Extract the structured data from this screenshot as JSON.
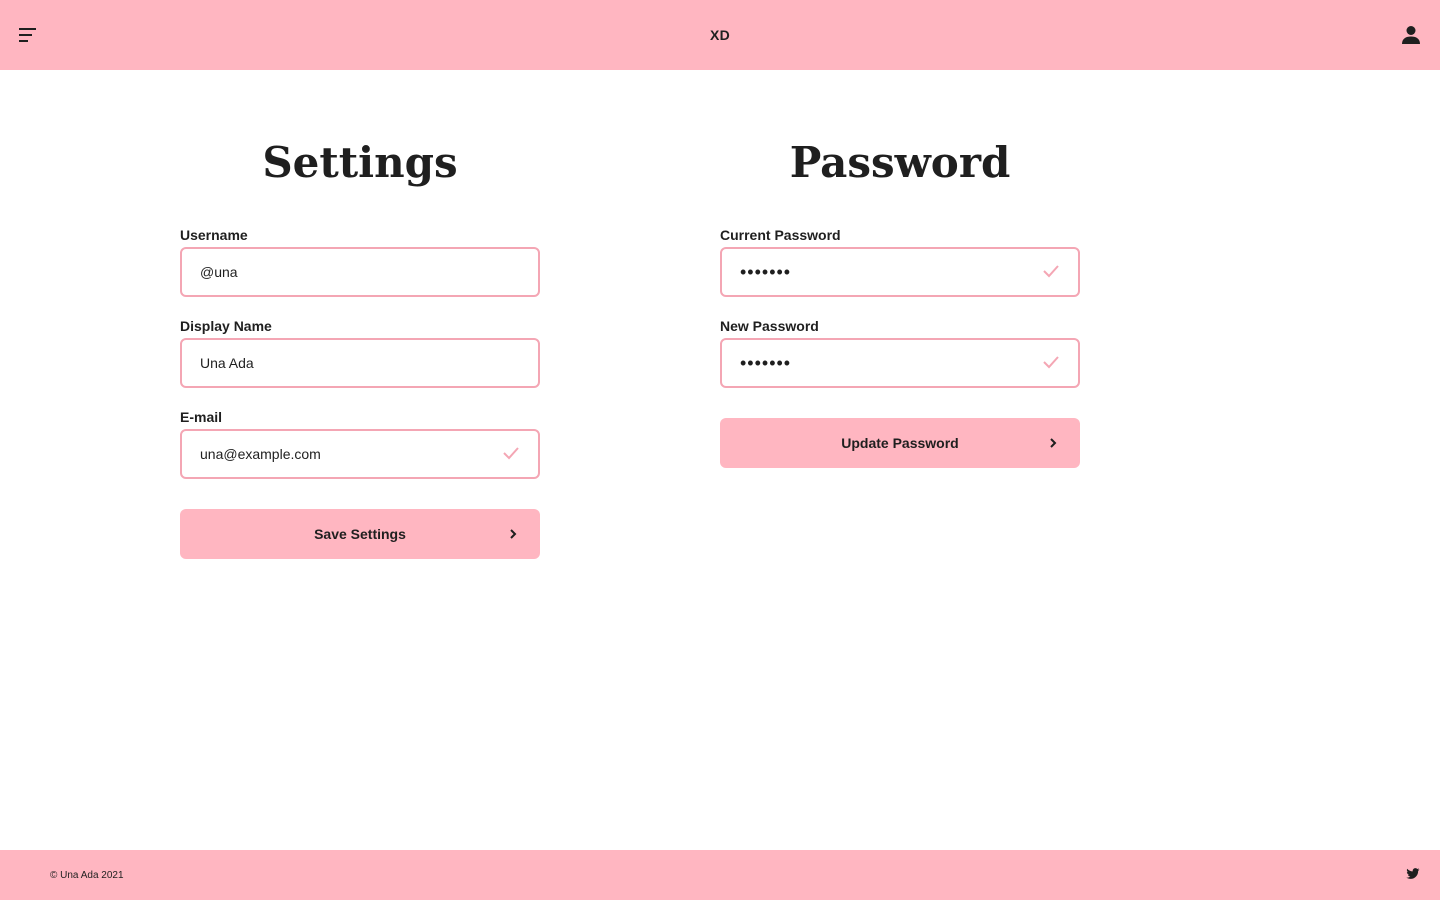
{
  "header": {
    "brand": "XD",
    "menu_icon": "hamburger-icon",
    "user_icon": "user-icon"
  },
  "settings": {
    "title": "Settings",
    "username": {
      "label": "Username",
      "value": "@una"
    },
    "display_name": {
      "label": "Display Name",
      "value": "Una Ada"
    },
    "email": {
      "label": "E-mail",
      "value": "una@example.com",
      "valid": true
    },
    "save_label": "Save Settings"
  },
  "password": {
    "title": "Password",
    "current": {
      "label": "Current Password",
      "value": "•••••••",
      "valid": true
    },
    "new": {
      "label": "New Password",
      "value": "•••••••",
      "valid": true
    },
    "update_label": "Update Password"
  },
  "footer": {
    "copyright": "© Una Ada 2021",
    "social_icon": "twitter-icon"
  },
  "colors": {
    "accent": "#ffb6c1",
    "field_border": "#f4a6b4",
    "text": "#1f1f1f"
  }
}
